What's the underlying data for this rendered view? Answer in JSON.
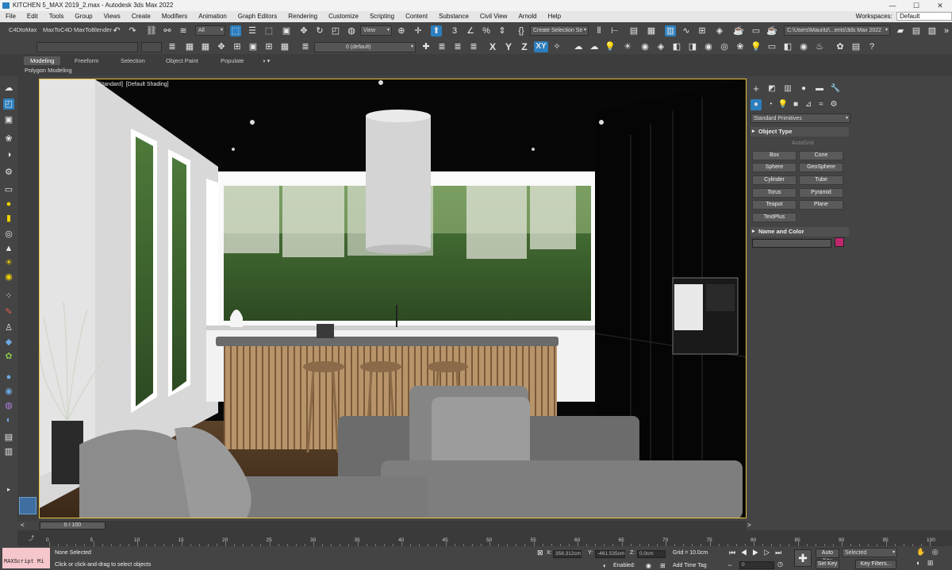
{
  "window": {
    "title": "KITCHEN 5_MAX 2019_2.max - Autodesk 3ds Max 2022"
  },
  "menu": {
    "items": [
      "File",
      "Edit",
      "Tools",
      "Group",
      "Views",
      "Create",
      "Modifiers",
      "Animation",
      "Graph Editors",
      "Rendering",
      "Customize",
      "Scripting",
      "Content",
      "Substance",
      "Civil View",
      "Arnold",
      "Help"
    ],
    "workspaces_label": "Workspaces:",
    "workspaces_value": "Default"
  },
  "toolbar": {
    "c4d_to_max": "C4DtoMax",
    "max_to_c4d": "MaxToC4D",
    "max_to_blender": "MaxToBlender",
    "selection_filter": "All",
    "ref_coord": "View",
    "selection_set": "Create Selection Se",
    "project_path": "C:\\Users\\Mauritz\\...ents\\3ds Max 2022",
    "layer": "0 (default)",
    "axis_x": "X",
    "axis_y": "Y",
    "axis_z": "Z",
    "axis_xy": "XY"
  },
  "ribbon": {
    "tabs": [
      "Modeling",
      "Freeform",
      "Selection",
      "Object Paint",
      "Populate"
    ],
    "active_tab": "Modeling",
    "panel_label": "Polygon Modeling"
  },
  "viewport": {
    "labels": [
      "[+]",
      "[Corona Camera]",
      "[Standard]",
      "[Default Shading]"
    ]
  },
  "command_panel": {
    "category": "Standard Primitives",
    "object_type_title": "Object Type",
    "autogrid": "AutoGrid",
    "buttons": [
      "Box",
      "Cone",
      "Sphere",
      "GeoSphere",
      "Cylinder",
      "Tube",
      "Torus",
      "Pyramid",
      "Teapot",
      "Plane",
      "TextPlus"
    ],
    "name_color_title": "Name and Color",
    "object_color": "#c0266e"
  },
  "timeline": {
    "frame_display": "0 / 100",
    "ticks": [
      0,
      5,
      10,
      15,
      20,
      25,
      30,
      35,
      40,
      45,
      50,
      55,
      60,
      65,
      70,
      75,
      80,
      85,
      90,
      95,
      100
    ]
  },
  "status": {
    "maxscript": "MAXScript Mi",
    "selection": "None Selected",
    "prompt": "Click or click-and-drag to select objects",
    "x_label": "X:",
    "x_value": "358.312cm",
    "y_label": "Y:",
    "y_value": "-461.535cm",
    "z_label": "Z:",
    "z_value": "0.0cm",
    "grid": "Grid = 10.0cm",
    "enabled": "Enabled:",
    "add_time_tag": "Add Time Tag",
    "auto_key": "Auto Key",
    "set_key": "Set Key",
    "key_mode": "Selected",
    "key_filters": "Key Filters...",
    "current_frame": "0"
  },
  "colors": {
    "accent": "#2b7fbf",
    "viewport_border": "#e6c542"
  }
}
